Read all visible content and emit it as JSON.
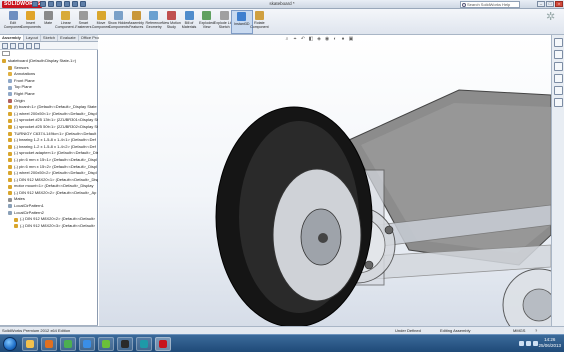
{
  "titlebar": {
    "logo": "SOLIDWORKS",
    "doc_title": "skateboard *",
    "search_placeholder": "Search SolidWorks Help"
  },
  "toolbar": {
    "items": [
      {
        "label": "Edit Component",
        "color": "#6f8fc0"
      },
      {
        "label": "Insert Components",
        "color": "#e0a42a"
      },
      {
        "label": "Mate",
        "color": "#8a8a8a"
      },
      {
        "label": "Linear Component...",
        "color": "#d8aa38"
      },
      {
        "label": "Smart Fasteners",
        "color": "#9a9a9a"
      },
      {
        "label": "Move Component",
        "color": "#d9a62d"
      },
      {
        "label": "Show Hidden Components",
        "color": "#7aa0c8"
      },
      {
        "label": "Assembly Features",
        "color": "#c9973a"
      },
      {
        "label": "Reference Geometry",
        "color": "#6aa0d0"
      },
      {
        "label": "New Motion Study",
        "color": "#c05050"
      },
      {
        "label": "Bill of Materials",
        "color": "#4f8ccc"
      },
      {
        "label": "Exploded View",
        "color": "#5fa05f"
      },
      {
        "label": "Explode Line Sketch",
        "color": "#a0a0a0"
      },
      {
        "label": "Instant3D",
        "color": "#3f7fcf"
      },
      {
        "label": "Rotate Component",
        "color": "#d0a040"
      }
    ]
  },
  "panel": {
    "tabs": [
      "Assembly",
      "Layout",
      "Sketch",
      "Evaluate",
      "Office Products"
    ],
    "tree": [
      {
        "indent": 0,
        "label": "skateboard  (Default<Display State-1>)",
        "color": "#d9a62d"
      },
      {
        "indent": 1,
        "label": "Sensors",
        "color": "#c9a040"
      },
      {
        "indent": 1,
        "label": "Annotations",
        "color": "#e0b040"
      },
      {
        "indent": 1,
        "label": "Front Plane",
        "color": "#8fa8c8"
      },
      {
        "indent": 1,
        "label": "Top Plane",
        "color": "#8fa8c8"
      },
      {
        "indent": 1,
        "label": "Right Plane",
        "color": "#8fa8c8"
      },
      {
        "indent": 1,
        "label": "Origin",
        "color": "#b06060"
      },
      {
        "indent": 1,
        "label": "(f) board<1> (Default<<Default>_Display State",
        "color": "#d9a62d"
      },
      {
        "indent": 1,
        "label": "(-) wheel 200x50<1> (Default<<Default>_Displ",
        "color": "#d9a62d"
      },
      {
        "indent": 1,
        "label": "(-) sprocket #25 13t<1> (2ZUBR301<Display St",
        "color": "#d9a62d"
      },
      {
        "indent": 1,
        "label": "(-) sprocket #25 50t<1> (2ZUBR302<Display St",
        "color": "#d9a62d"
      },
      {
        "indent": 1,
        "label": "TURNIGY C6374-149kv<1> (Default<<Default",
        "color": "#d9a62d"
      },
      {
        "indent": 1,
        "label": "(-) bearing 1-2 x 1-5-8 x 1-4<1> (Default<<Def",
        "color": "#d9a62d"
      },
      {
        "indent": 1,
        "label": "(-) bearing 1-2 x 1-5-8 x 1-4<2> (Default<<Def",
        "color": "#d9a62d"
      },
      {
        "indent": 1,
        "label": "(-) sprocket adapter<1> (Default<<Default>_Displ",
        "color": "#d9a62d"
      },
      {
        "indent": 1,
        "label": "(-) pin 6 mm x 15<1> (Default<<Default>_Displ",
        "color": "#d9a62d"
      },
      {
        "indent": 1,
        "label": "(-) pin 6 mm x 15<2> (Default<<Default>_Displ",
        "color": "#d9a62d"
      },
      {
        "indent": 1,
        "label": "(-) wheel 200x50<2> (Default<<Default>_Displ",
        "color": "#d9a62d"
      },
      {
        "indent": 1,
        "label": "(-) DIN 912 M8X20<1> (Default<<Default>_Disp",
        "color": "#d9a62d"
      },
      {
        "indent": 1,
        "label": "motor mount<1> (Default<<Default>_Display",
        "color": "#d9a62d"
      },
      {
        "indent": 1,
        "label": "(-) DIN 912 M8X20<2> (Default<<Default>_Ap",
        "color": "#d9a62d"
      },
      {
        "indent": 1,
        "label": "Mates",
        "color": "#909090"
      },
      {
        "indent": 1,
        "label": "LocalCirPattern1",
        "color": "#8aa0b8"
      },
      {
        "indent": 1,
        "label": "LocalCirPattern2",
        "color": "#8aa0b8"
      },
      {
        "indent": 2,
        "label": "(-) DIN 912 M8X20<2> (Default<<Default>",
        "color": "#d9a62d"
      },
      {
        "indent": 2,
        "label": "(-) DIN 912 M8X20<3> (Default<<Default>",
        "color": "#d9a62d"
      }
    ],
    "bottom_tabs": [
      "Model",
      "Motion Study 1"
    ]
  },
  "status": {
    "left": "SolidWorks Premium 2012 x64 Edition",
    "state": "Under Defined",
    "mode": "Editing Assembly",
    "units": "MMGS"
  },
  "taskbar": {
    "apps": [
      {
        "name": "explorer-app",
        "color": "#f2c14e"
      },
      {
        "name": "media-player-app",
        "color": "#e07020"
      },
      {
        "name": "chrome-app",
        "color": "#4caf50"
      },
      {
        "name": "ie-app",
        "color": "#3a8ee6"
      },
      {
        "name": "utorrent-app",
        "color": "#6abf3a"
      },
      {
        "name": "steam-app",
        "color": "#2a2a2a"
      },
      {
        "name": "arduino-app",
        "color": "#1e9aa8"
      },
      {
        "name": "solidworks-app",
        "color": "#c8141e"
      }
    ],
    "time": "14:26",
    "date": "25/06/2013"
  }
}
